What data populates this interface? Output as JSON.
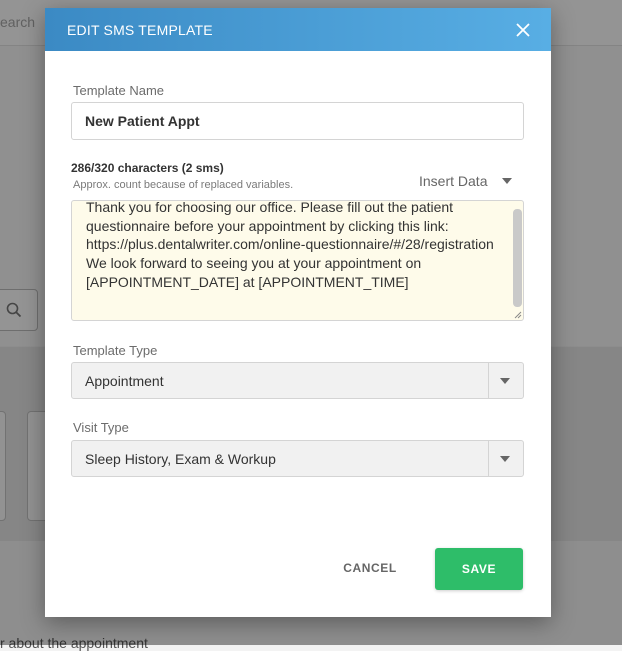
{
  "background": {
    "search_partial": "earch",
    "bottom_text_partial": "r about the appointment"
  },
  "modal": {
    "title": "EDIT SMS TEMPLATE",
    "header_gradient": [
      "#3b8ac4",
      "#58aee4"
    ],
    "template_name": {
      "label": "Template Name",
      "value": "New Patient Appt"
    },
    "message": {
      "char_count": "286/320 characters (2 sms)",
      "approx_note": "Approx. count because of replaced variables.",
      "insert_data_label": "Insert Data",
      "body": "Thank you for choosing our office. Please fill out the patient questionnaire before your appointment by clicking this link: https://plus.dentalwriter.com/online-questionnaire/#/28/registration\nWe look forward to seeing you at your appointment on [APPOINTMENT_DATE] at [APPOINTMENT_TIME]"
    },
    "template_type": {
      "label": "Template Type",
      "value": "Appointment"
    },
    "visit_type": {
      "label": "Visit Type",
      "value": "Sleep History, Exam & Workup"
    },
    "actions": {
      "cancel_label": "CANCEL",
      "save_label": "SAVE",
      "save_color": "#2ebd69"
    }
  }
}
